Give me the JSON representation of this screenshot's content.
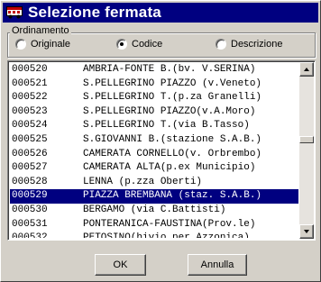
{
  "window": {
    "title": "Selezione fermata",
    "icon": "bus-icon"
  },
  "ordering": {
    "legend": "Ordinamento",
    "options": [
      {
        "label": "Originale",
        "selected": false
      },
      {
        "label": "Codice",
        "selected": true
      },
      {
        "label": "Descrizione",
        "selected": false
      }
    ]
  },
  "stops": [
    {
      "code": "000520",
      "name": "AMBRIA-FONTE B.(bv. V.SERINA)",
      "selected": false
    },
    {
      "code": "000521",
      "name": "S.PELLEGRINO PIAZZO (v.Veneto)",
      "selected": false
    },
    {
      "code": "000522",
      "name": "S.PELLEGRINO T.(p.za Granelli)",
      "selected": false
    },
    {
      "code": "000523",
      "name": "S.PELLEGRINO PIAZZO(v.A.Moro)",
      "selected": false
    },
    {
      "code": "000524",
      "name": "S.PELLEGRINO T.(via B.Tasso)",
      "selected": false
    },
    {
      "code": "000525",
      "name": "S.GIOVANNI B.(stazione S.A.B.)",
      "selected": false
    },
    {
      "code": "000526",
      "name": "CAMERATA CORNELLO(v. Orbrembo)",
      "selected": false
    },
    {
      "code": "000527",
      "name": "CAMERATA ALTA(p.ex Municipio)",
      "selected": false
    },
    {
      "code": "000528",
      "name": "LENNA (p.zza Oberti)",
      "selected": false
    },
    {
      "code": "000529",
      "name": "PIAZZA BREMBANA (staz. S.A.B.)",
      "selected": true
    },
    {
      "code": "000530",
      "name": "BERGAMO (via C.Battisti)",
      "selected": false
    },
    {
      "code": "000531",
      "name": "PONTERANICA-FAUSTINA(Prov.le)",
      "selected": false
    },
    {
      "code": "000532",
      "name": "PETOSINO(bivio per Azzonica)",
      "selected": false
    }
  ],
  "buttons": {
    "ok": "OK",
    "cancel": "Annulla"
  },
  "colors": {
    "selection": "#000080",
    "face": "#d4d0c8",
    "titlebar": "#000080"
  }
}
